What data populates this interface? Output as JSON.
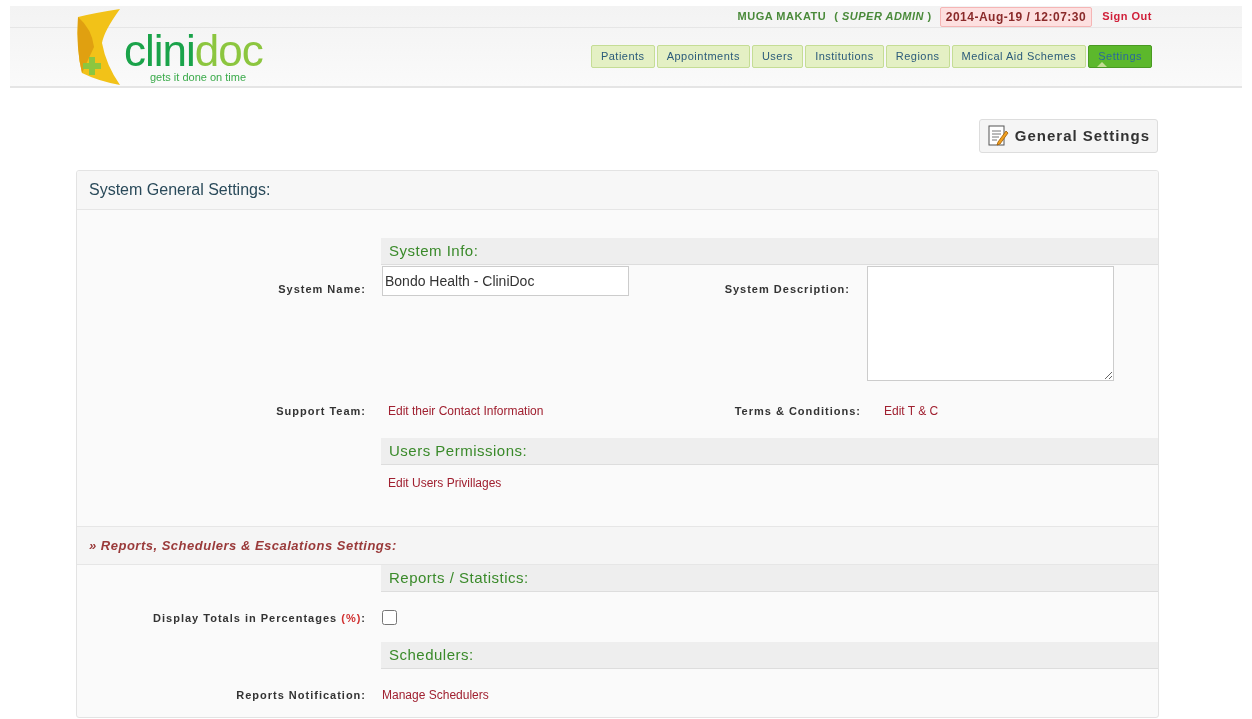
{
  "header": {
    "logo": {
      "name_first": "clini",
      "name_second": "doc",
      "tagline": "gets it done on time"
    },
    "user_name": "MUGA MAKATU",
    "role": "( *SUPER ADMIN* )",
    "datetime": "2014-Aug-19 / 12:07:30",
    "sign_out": "Sign Out",
    "nav": [
      {
        "label": "Patients",
        "selected": false
      },
      {
        "label": "Appointments",
        "selected": false
      },
      {
        "label": "Users",
        "selected": false
      },
      {
        "label": "Institutions",
        "selected": false
      },
      {
        "label": "Regions",
        "selected": false
      },
      {
        "label": "Medical Aid Schemes",
        "selected": false
      },
      {
        "label": "Settings",
        "selected": true
      }
    ]
  },
  "page_button": "General Settings",
  "panel": {
    "title": "System General Settings:",
    "system_info": {
      "heading": "System Info:",
      "system_name": {
        "label": "System Name:",
        "value": "Bondo Health - CliniDoc"
      },
      "system_description": {
        "label": "System Description:"
      }
    },
    "support_team": {
      "label": "Support Team:",
      "link": "Edit their Contact Information"
    },
    "terms": {
      "label": "Terms & Conditions:",
      "link": "Edit T & C"
    },
    "users_permissions": {
      "heading": "Users Permissions:",
      "link": "Edit Users Privillages"
    },
    "reports_section": {
      "title": "» Reports, Schedulers & Escalations Settings:"
    },
    "reports_statistics": {
      "heading": "Reports / Statistics:",
      "display_totals": {
        "label": "Display Totals in Percentages",
        "mark": "(%)",
        "suffix": ":",
        "checked": false
      }
    },
    "schedulers": {
      "heading": "Schedulers:",
      "reports_notification": {
        "label": "Reports Notification:",
        "link": "Manage Schedulers"
      }
    }
  }
}
